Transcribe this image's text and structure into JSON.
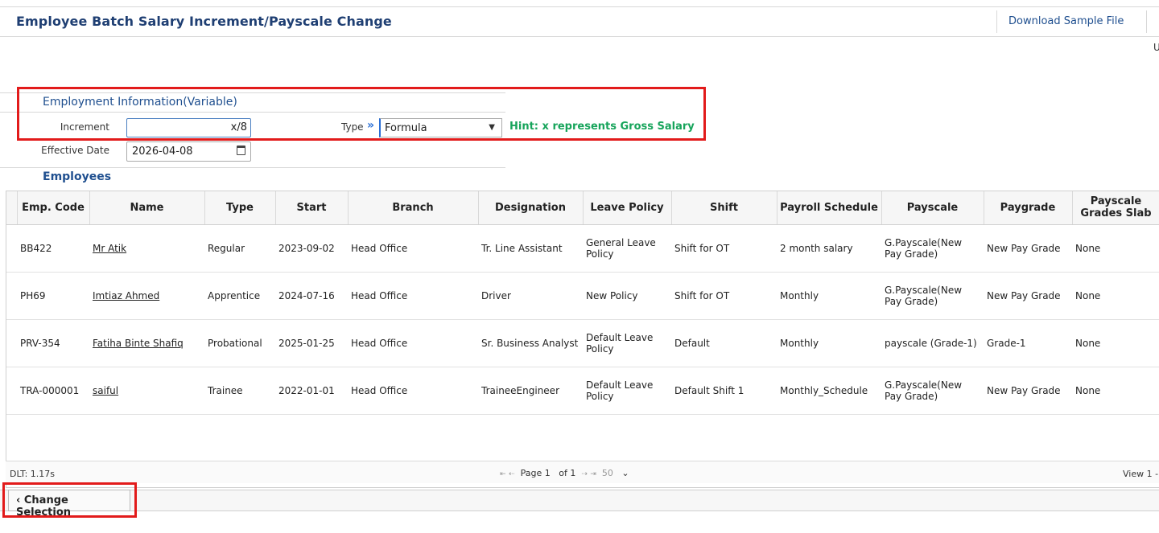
{
  "header": {
    "title": "Employee Batch Salary Increment/Payscale Change",
    "download_label": "Download Sample File",
    "corner_text": "U"
  },
  "form": {
    "section_title": "Employment Information(Variable)",
    "increment_label": "Increment",
    "increment_value": "x/8",
    "type_label": "Type",
    "type_chevron": "»",
    "type_value": "Formula",
    "hint": "Hint: x represents Gross Salary",
    "effective_date_label": "Effective Date",
    "effective_date_value": "2026-04-08",
    "employees_title": "Employees"
  },
  "table": {
    "columns": [
      "Emp. Code",
      "Name",
      "Type",
      "Start",
      "Branch",
      "Designation",
      "Leave Policy",
      "Shift",
      "Payroll Schedule",
      "Payscale",
      "Paygrade",
      "Payscale Grades Slab"
    ],
    "rows": [
      [
        "BB422",
        "Mr Atik",
        "Regular",
        "2023-09-02",
        "Head Office",
        "Tr. Line Assistant",
        "General Leave Policy",
        "Shift for OT",
        "2 month salary",
        "G.Payscale(New Pay Grade)",
        "New Pay Grade",
        "None"
      ],
      [
        "PH69",
        "Imtiaz Ahmed",
        "Apprentice",
        "2024-07-16",
        "Head Office",
        "Driver",
        "New Policy",
        "Shift for OT",
        "Monthly",
        "G.Payscale(New Pay Grade)",
        "New Pay Grade",
        "None"
      ],
      [
        "PRV-354",
        "Fatiha Binte Shafiq",
        "Probational",
        "2025-01-25",
        "Head Office",
        "Sr. Business Analyst",
        "Default Leave Policy",
        "Default",
        "Monthly",
        "payscale (Grade-1)",
        "Grade-1",
        "None"
      ],
      [
        "TRA-000001",
        "saiful",
        "Trainee",
        "2022-01-01",
        "Head Office",
        "TraineeEngineer",
        "Default Leave Policy",
        "Default Shift 1",
        "Monthly_Schedule",
        "G.Payscale(New Pay Grade)",
        "New Pay Grade",
        "None"
      ]
    ]
  },
  "footer": {
    "dlt": "DLT: 1.17s",
    "first": "⇤",
    "prev": "⇠",
    "page_label": "Page 1",
    "of_label": "of 1",
    "next": "⇢",
    "last": "⇥",
    "page_size": "50",
    "view": "View 1 -"
  },
  "bottom": {
    "change_selection_label": "Change Selection"
  }
}
